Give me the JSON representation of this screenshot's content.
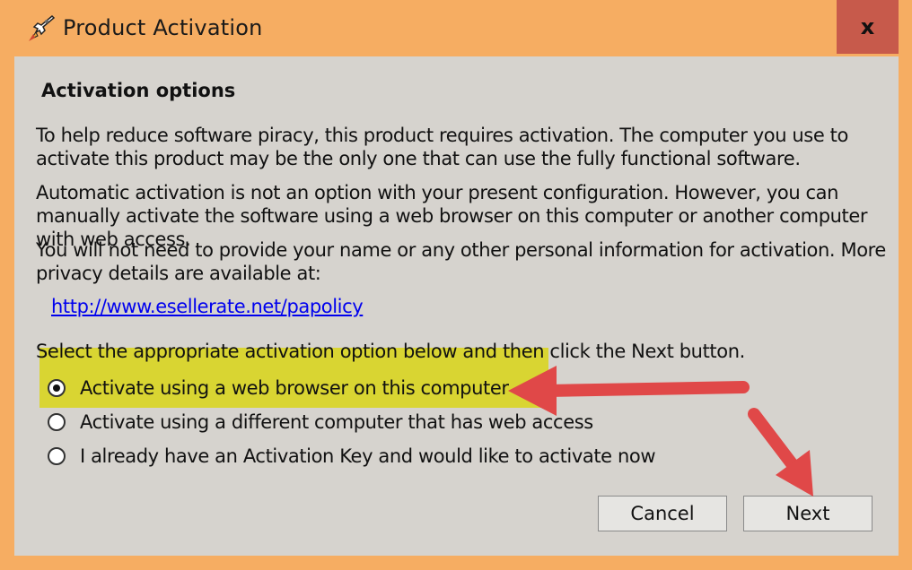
{
  "window": {
    "title": "Product Activation",
    "close_label": "x"
  },
  "content": {
    "heading": "Activation options",
    "paragraphs": [
      "To help reduce software piracy, this product requires activation. The computer you use to activate this product may be the only one that can use the fully functional software.",
      "Automatic activation is not an option with your present configuration. However, you can manually activate the software using a web browser on this computer or another computer with web access.",
      "You will not need to provide your name or any other personal information for activation. More privacy details are available at:"
    ],
    "privacy_link": "http://www.esellerate.net/papolicy",
    "instruction": "Select the appropriate activation option below and then click the Next button.",
    "options": [
      {
        "label": "Activate using a web browser on this computer",
        "selected": true
      },
      {
        "label": "Activate using a different computer that has web access",
        "selected": false
      },
      {
        "label": "I already have an Activation Key and would like to activate now",
        "selected": false
      }
    ]
  },
  "buttons": {
    "cancel": "Cancel",
    "next": "Next"
  },
  "annotations": {
    "highlight_color": "#d9d532",
    "arrow_color": "#e04848"
  }
}
